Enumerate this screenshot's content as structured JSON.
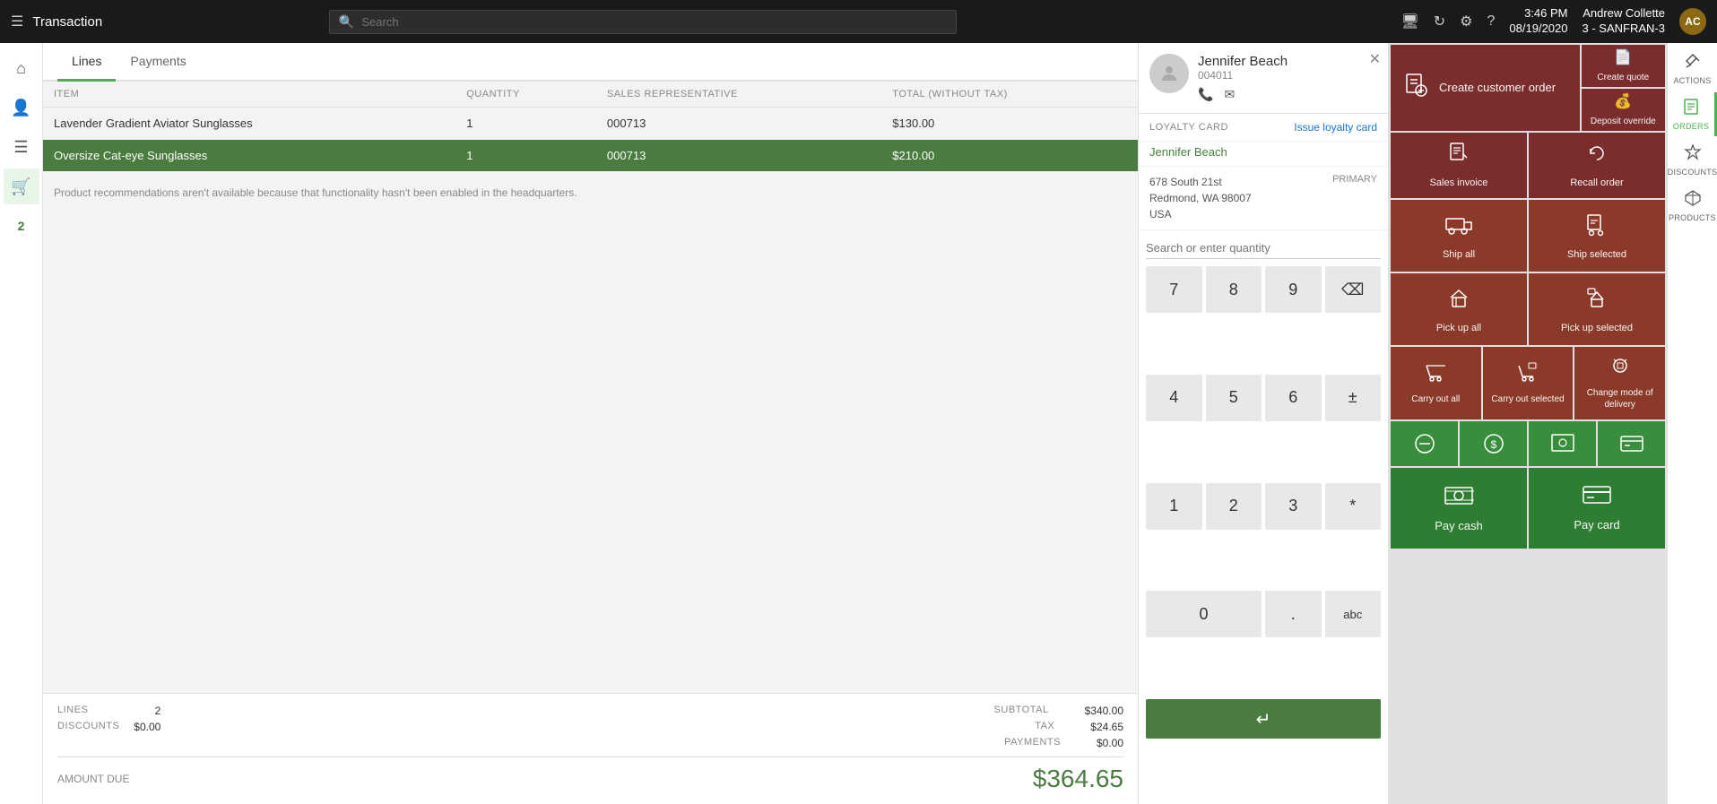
{
  "app": {
    "title": "Transaction",
    "time": "3:46 PM",
    "date": "08/19/2020",
    "store": "3 - SANFRAN-3",
    "user": "Andrew Collette",
    "avatar_initials": "AC"
  },
  "search": {
    "placeholder": "Search"
  },
  "tabs": [
    {
      "id": "lines",
      "label": "Lines",
      "active": true
    },
    {
      "id": "payments",
      "label": "Payments",
      "active": false
    }
  ],
  "table": {
    "headers": [
      "ITEM",
      "QUANTITY",
      "SALES REPRESENTATIVE",
      "TOTAL (WITHOUT TAX)"
    ],
    "rows": [
      {
        "item": "Lavender Gradient Aviator Sunglasses",
        "quantity": "1",
        "rep": "000713",
        "total": "$130.00",
        "selected": false
      },
      {
        "item": "Oversize Cat-eye Sunglasses",
        "quantity": "1",
        "rep": "000713",
        "total": "$210.00",
        "selected": true
      }
    ]
  },
  "recommendation_msg": "Product recommendations aren't available because that functionality hasn't been enabled in the headquarters.",
  "summary": {
    "lines_label": "LINES",
    "lines_value": "2",
    "discounts_label": "DISCOUNTS",
    "discounts_value": "$0.00",
    "subtotal_label": "SUBTOTAL",
    "subtotal_value": "$340.00",
    "tax_label": "TAX",
    "tax_value": "$24.65",
    "payments_label": "PAYMENTS",
    "payments_value": "$0.00",
    "amount_due_label": "AMOUNT DUE",
    "amount_due_value": "$364.65"
  },
  "customer": {
    "name": "Jennifer Beach",
    "id": "004011",
    "address_line1": "678 South 21st",
    "address_line2": "Redmond, WA 98007",
    "address_line3": "USA",
    "loyalty_card_label": "LOYALTY CARD",
    "loyalty_card_link": "Issue loyalty card",
    "loyalty_name": "Jennifer Beach",
    "primary_badge": "PRIMARY"
  },
  "numpad": {
    "search_placeholder": "Search or enter quantity",
    "keys": [
      "7",
      "8",
      "9",
      "⌫",
      "4",
      "5",
      "6",
      "±",
      "1",
      "2",
      "3",
      "*",
      "0",
      ".",
      "abc"
    ]
  },
  "tiles": {
    "row1": [
      {
        "id": "create-customer-order",
        "label": "Create customer order",
        "icon": "📋",
        "color": "dark-red",
        "wide": true
      },
      {
        "id": "create-quote",
        "label": "Create quote",
        "icon": "📄",
        "color": "dark-red"
      },
      {
        "id": "deposit-override",
        "label": "Deposit override",
        "icon": "💰",
        "color": "dark-red"
      }
    ],
    "row2": [
      {
        "id": "sales-invoice",
        "label": "Sales invoice",
        "icon": "🧾",
        "color": "dark-red"
      },
      {
        "id": "recall-order",
        "label": "Recall order",
        "icon": "↩",
        "color": "dark-red"
      }
    ],
    "row3": [
      {
        "id": "ship-all",
        "label": "Ship all",
        "icon": "🚚",
        "color": "medium-red"
      },
      {
        "id": "ship-selected",
        "label": "Ship selected",
        "icon": "📦",
        "color": "medium-red"
      }
    ],
    "row4": [
      {
        "id": "pick-up-all",
        "label": "Pick up all",
        "icon": "🛍",
        "color": "medium-red"
      },
      {
        "id": "pick-up-selected",
        "label": "Pick up selected",
        "icon": "🏪",
        "color": "medium-red"
      }
    ],
    "row5": [
      {
        "id": "carry-out-all",
        "label": "Carry out all",
        "icon": "🛒",
        "color": "medium-red"
      },
      {
        "id": "carry-out-selected",
        "label": "Carry out selected",
        "icon": "🛒",
        "color": "medium-red"
      },
      {
        "id": "change-mode-delivery",
        "label": "Change mode of delivery",
        "icon": "🔄",
        "color": "medium-red"
      }
    ],
    "row6": [
      {
        "id": "icon1",
        "label": "",
        "icon": "⊖",
        "color": "green"
      },
      {
        "id": "icon2",
        "label": "",
        "icon": "💲",
        "color": "green"
      },
      {
        "id": "icon3",
        "label": "",
        "icon": "🖼",
        "color": "green"
      },
      {
        "id": "icon4",
        "label": "",
        "icon": "💳",
        "color": "green"
      }
    ],
    "row7": [
      {
        "id": "pay-cash",
        "label": "Pay cash",
        "icon": "💵",
        "color": "dark-green"
      },
      {
        "id": "pay-card",
        "label": "Pay card",
        "icon": "💳",
        "color": "dark-green"
      }
    ]
  },
  "right_icons": [
    {
      "id": "actions",
      "label": "ACTIONS",
      "icon": "⚡",
      "active": false
    },
    {
      "id": "orders",
      "label": "ORDERS",
      "icon": "☰",
      "active": true
    },
    {
      "id": "discounts",
      "label": "DISCOUNTS",
      "icon": "🏷",
      "active": false
    },
    {
      "id": "products",
      "label": "PRODUCTS",
      "icon": "📦",
      "active": false
    }
  ],
  "sidebar_icons": [
    {
      "id": "home",
      "icon": "⌂"
    },
    {
      "id": "users",
      "icon": "👥"
    },
    {
      "id": "menu",
      "icon": "☰"
    },
    {
      "id": "cart",
      "icon": "🛒",
      "active": true
    },
    {
      "id": "badge2",
      "label": "2"
    }
  ]
}
